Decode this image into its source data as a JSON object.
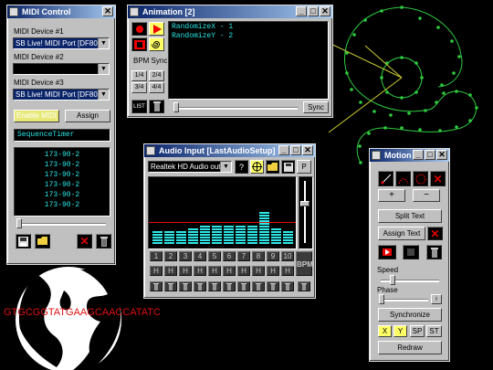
{
  "midi_control": {
    "title": "MIDI Control",
    "device1_label": "MIDI Device #1",
    "device1_value": "SB Live! MIDI Port [DF80]",
    "device2_label": "MIDI Device #2",
    "device2_value": "",
    "device3_label": "MIDI Device #3",
    "device3_value": "SB Live! MIDI Port [DF80]",
    "enable_label": "Enable MIDI",
    "assign_label": "Assign",
    "sequence_value": "SequenceTimer",
    "list": [
      "173-90-2",
      "173-90-2",
      "173-90-2",
      "173-90-2",
      "173-90-2",
      "173-90-2"
    ]
  },
  "animation": {
    "title": "Animation [2]",
    "bpm_sync_label": "BPM Sync",
    "time_sigs": [
      "1/4",
      "2/4",
      "3/4",
      "4/4"
    ],
    "lines": [
      "RandomizeX - 1",
      "RandomizeY - 2"
    ],
    "sync_label": "Sync",
    "list_label": "LIST"
  },
  "audio_input": {
    "title": "Audio Input [LastAudioSetup]",
    "device_value": "Realtek HD Audio output",
    "help_label": "?",
    "p_label": "P",
    "bpm_label": "BPM",
    "bands": [
      "1",
      "2",
      "3",
      "4",
      "5",
      "6",
      "7",
      "8",
      "9",
      "10"
    ],
    "h_label": "H",
    "band_levels": [
      5,
      5,
      5,
      6,
      7,
      7,
      7,
      7,
      7,
      12,
      6,
      5
    ]
  },
  "motion": {
    "title": "Motion",
    "plus_label": "+",
    "minus_label": "−",
    "split_text_label": "Split Text",
    "assign_text_label": "Assign Text",
    "speed_label": "Speed",
    "phase_label": "Phase",
    "synchronize_label": "Synchronize",
    "x_label": "X",
    "y_label": "Y",
    "sp_label": "SP",
    "st_label": "ST",
    "redraw_label": "Redraw"
  },
  "canvas": {
    "dna_text": "GTGCGGTATGAAGCAACCATATC"
  },
  "colors": {
    "accent_cyan": "#2ee6e6",
    "title_blue": "#0a246a",
    "dna_red": "#e01010",
    "path_green": "#2ecc40",
    "line_yellow": "#cccc33"
  }
}
